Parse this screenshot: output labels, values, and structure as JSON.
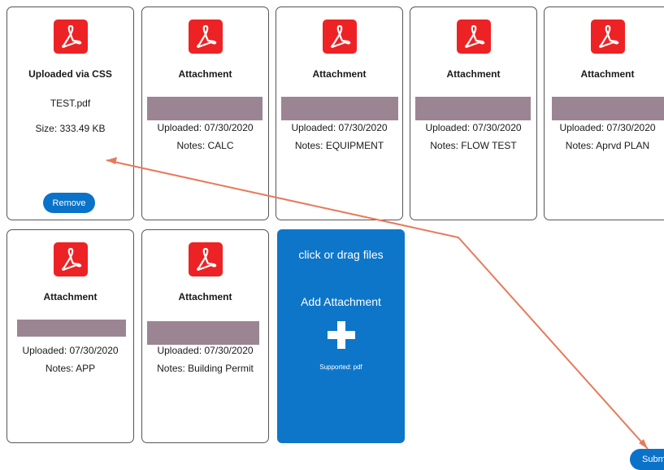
{
  "top_row": [
    {
      "title": "Uploaded via CSS",
      "filename": "TEST.pdf",
      "size": "Size: 333.49 KB",
      "button": "Remove"
    },
    {
      "title": "Attachment",
      "uploaded": "Uploaded: 07/30/2020",
      "notes": "Notes: CALC"
    },
    {
      "title": "Attachment",
      "uploaded": "Uploaded: 07/30/2020",
      "notes": "Notes: EQUIPMENT"
    },
    {
      "title": "Attachment",
      "uploaded": "Uploaded: 07/30/2020",
      "notes": "Notes: FLOW TEST"
    },
    {
      "title": "Attachment",
      "uploaded": "Uploaded: 07/30/2020",
      "notes": "Notes: Aprvd PLAN"
    }
  ],
  "bottom_row": [
    {
      "title": "Attachment",
      "uploaded": "Uploaded: 07/30/2020",
      "notes": "Notes: APP"
    },
    {
      "title": "Attachment",
      "uploaded": "Uploaded: 07/30/2020",
      "notes": "Notes: Building Permit"
    }
  ],
  "add_card": {
    "drag_text": "click or drag files",
    "add_text": "Add Attachment",
    "supported": "Supported: pdf"
  },
  "submit_label": "Subm",
  "colors": {
    "accent": "#0a72c9",
    "pdf_red": "#ed2224",
    "redaction": "#9b8593",
    "annotation_arrow": "#e8795a"
  },
  "icons": [
    "pdf-icon",
    "plus-icon"
  ]
}
